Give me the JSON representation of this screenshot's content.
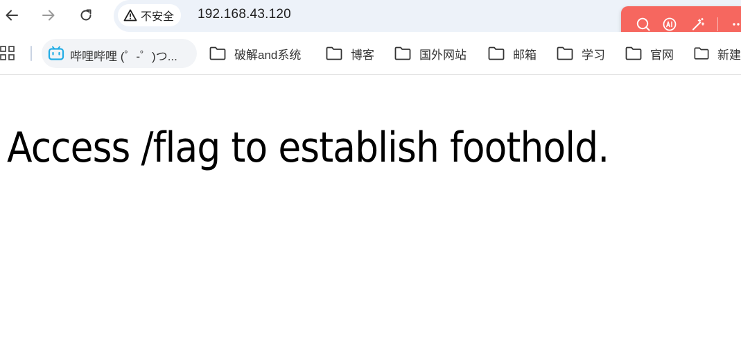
{
  "browser": {
    "security_label": "不安全",
    "url": "192.168.43.120",
    "icons": {
      "back": "arrow-left-icon",
      "forward": "arrow-right-icon",
      "reload": "reload-icon",
      "security": "warning-triangle-icon"
    },
    "extension_toolbar": {
      "color": "#f6675f",
      "icons": [
        "search-icon",
        "ai-icon",
        "magic-wand-icon",
        "more-icon"
      ]
    }
  },
  "bookmarks": {
    "apps_icon": "apps-grid-icon",
    "items": [
      {
        "label": "哔哩哔哩 (゜-゜)つ...",
        "icon": "bilibili-icon"
      },
      {
        "label": "破解and系统",
        "icon": "folder-icon"
      },
      {
        "label": "博客",
        "icon": "folder-icon"
      },
      {
        "label": "国外网站",
        "icon": "folder-icon"
      },
      {
        "label": "邮箱",
        "icon": "folder-icon"
      },
      {
        "label": "学习",
        "icon": "folder-icon"
      },
      {
        "label": "官网",
        "icon": "folder-icon"
      },
      {
        "label": "新建",
        "icon": "folder-icon"
      }
    ]
  },
  "page": {
    "headline": "Access /flag to establish foothold."
  }
}
